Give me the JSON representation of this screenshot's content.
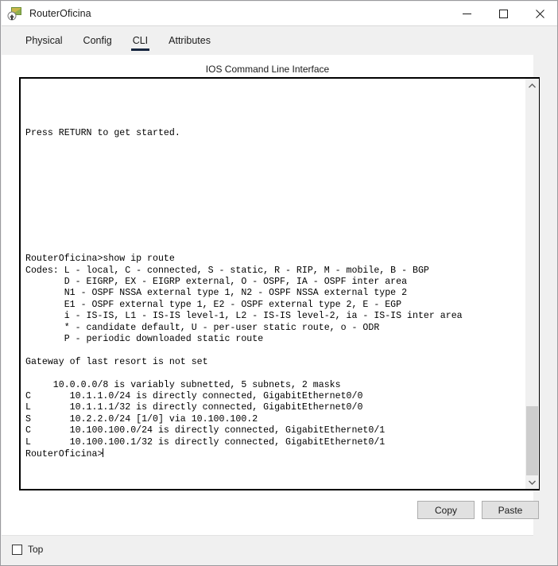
{
  "window": {
    "title": "RouterOficina",
    "icon": "router-device-icon",
    "controls": {
      "minimize": "minimize-icon",
      "maximize": "maximize-icon",
      "close": "close-icon"
    }
  },
  "tabs": {
    "items": [
      {
        "label": "Physical",
        "active": false
      },
      {
        "label": "Config",
        "active": false
      },
      {
        "label": "CLI",
        "active": true
      },
      {
        "label": "Attributes",
        "active": false
      }
    ],
    "active_index": 2,
    "active_underline_color": "#17263f"
  },
  "cli": {
    "heading": "IOS Command Line Interface",
    "prompt": "RouterOficina>",
    "terminal_text": "\n\n\n\nPress RETURN to get started.\n\n\n\n\n\n\n\n\n\n\nRouterOficina>show ip route\nCodes: L - local, C - connected, S - static, R - RIP, M - mobile, B - BGP\n       D - EIGRP, EX - EIGRP external, O - OSPF, IA - OSPF inter area\n       N1 - OSPF NSSA external type 1, N2 - OSPF NSSA external type 2\n       E1 - OSPF external type 1, E2 - OSPF external type 2, E - EGP\n       i - IS-IS, L1 - IS-IS level-1, L2 - IS-IS level-2, ia - IS-IS inter area\n       * - candidate default, U - per-user static route, o - ODR\n       P - periodic downloaded static route\n\nGateway of last resort is not set\n\n     10.0.0.0/8 is variably subnetted, 5 subnets, 2 masks\nC       10.1.1.0/24 is directly connected, GigabitEthernet0/0\nL       10.1.1.1/32 is directly connected, GigabitEthernet0/0\nS       10.2.2.0/24 [1/0] via 10.100.100.2\nC       10.100.100.0/24 is directly connected, GigabitEthernet0/1\nL       10.100.100.1/32 is directly connected, GigabitEthernet0/1\n",
    "command_entered": "show ip route",
    "routing_table": {
      "gateway_of_last_resort": "not set",
      "supernet": "10.0.0.0/8 is variably subnetted, 5 subnets, 2 masks",
      "rows": [
        {
          "code": "C",
          "network": "10.1.1.0/24",
          "detail": "is directly connected, GigabitEthernet0/0"
        },
        {
          "code": "L",
          "network": "10.1.1.1/32",
          "detail": "is directly connected, GigabitEthernet0/0"
        },
        {
          "code": "S",
          "network": "10.2.2.0/24",
          "detail": "[1/0] via 10.100.100.2"
        },
        {
          "code": "C",
          "network": "10.100.100.0/24",
          "detail": "is directly connected, GigabitEthernet0/1"
        },
        {
          "code": "L",
          "network": "10.100.100.1/32",
          "detail": "is directly connected, GigabitEthernet0/1"
        }
      ]
    },
    "codes_legend": [
      "Codes: L - local, C - connected, S - static, R - RIP, M - mobile, B - BGP",
      "D - EIGRP, EX - EIGRP external, O - OSPF, IA - OSPF inter area",
      "N1 - OSPF NSSA external type 1, N2 - OSPF NSSA external type 2",
      "E1 - OSPF external type 1, E2 - OSPF external type 2, E - EGP",
      "i - IS-IS, L1 - IS-IS level-1, L2 - IS-IS level-2, ia - IS-IS inter area",
      "* - candidate default, U - per-user static route, o - ODR",
      "P - periodic downloaded static route"
    ],
    "banner": "Press RETURN to get started."
  },
  "scrollbar": {
    "up_arrow": "chevron-up-icon",
    "down_arrow": "chevron-down-icon",
    "thumb_color": "#cdcdcd"
  },
  "actions": {
    "copy_label": "Copy",
    "paste_label": "Paste"
  },
  "footer": {
    "top_checkbox_label": "Top",
    "top_checked": false
  }
}
